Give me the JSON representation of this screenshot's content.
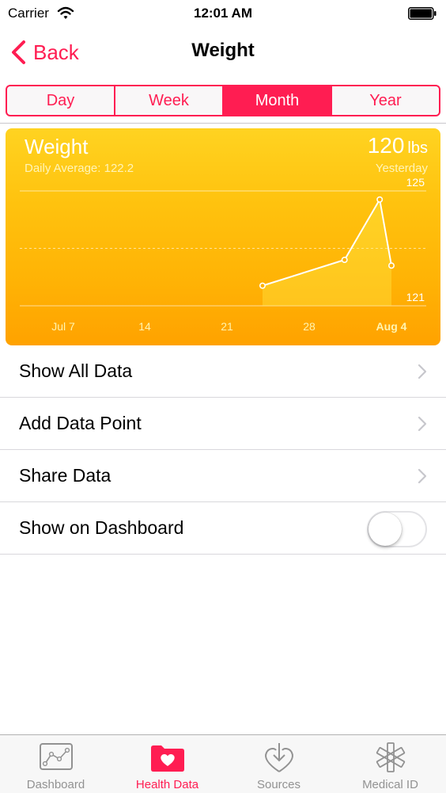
{
  "status": {
    "carrier": "Carrier",
    "time": "12:01 AM"
  },
  "nav": {
    "back_label": "Back",
    "title": "Weight"
  },
  "segments": [
    "Day",
    "Week",
    "Month",
    "Year"
  ],
  "selected_segment": "Month",
  "chart": {
    "title": "Weight",
    "subtitle": "Daily Average: 122.2",
    "value": "120",
    "unit": "lbs",
    "date": "Yesterday"
  },
  "chart_data": {
    "type": "line",
    "title": "Weight",
    "y_ticks": [
      "125",
      "121"
    ],
    "ylim": [
      121,
      125
    ],
    "x_tick_labels": [
      "Jul 7",
      "14",
      "21",
      "28",
      "Aug 4"
    ],
    "series": [
      {
        "x": [
          "Jul 24",
          "Jul 31",
          "Aug 3",
          "Aug 4"
        ],
        "values": [
          121.7,
          122.6,
          124.7,
          122.4
        ]
      }
    ],
    "grid": true,
    "color": "#ffffff"
  },
  "list": {
    "rows": [
      "Show All Data",
      "Add Data Point",
      "Share Data"
    ],
    "toggle_label": "Show on Dashboard",
    "toggle_on": false
  },
  "tabs": [
    {
      "label": "Dashboard",
      "icon": "dashboard-chart-icon"
    },
    {
      "label": "Health Data",
      "icon": "health-data-folder-heart-icon"
    },
    {
      "label": "Sources",
      "icon": "sources-download-heart-icon"
    },
    {
      "label": "Medical ID",
      "icon": "medical-id-star-of-life-icon"
    }
  ],
  "colors": {
    "accent": "#ff1d52",
    "chart_top": "#ffd321",
    "chart_bottom": "#ffa200",
    "tab_inactive": "#929292"
  }
}
